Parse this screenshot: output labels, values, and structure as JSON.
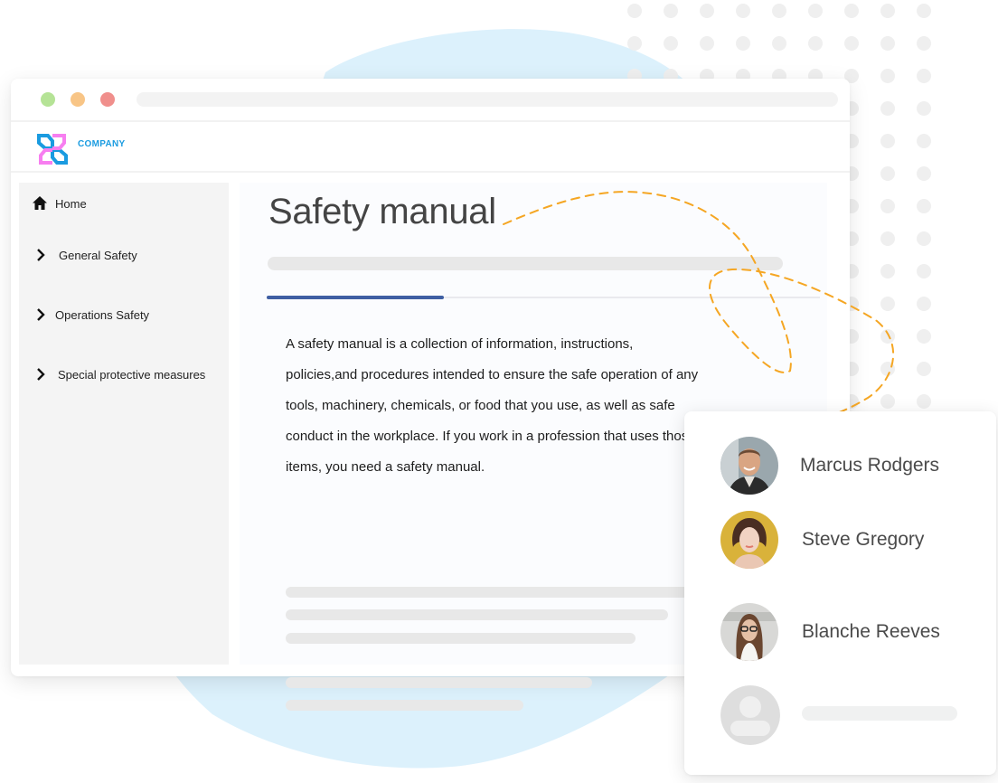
{
  "window": {
    "traffic_lights": [
      {
        "name": "green",
        "color": "#b5e396"
      },
      {
        "name": "yellow",
        "color": "#f8c586"
      },
      {
        "name": "red",
        "color": "#f08f8c"
      }
    ]
  },
  "app": {
    "brand_name": "COMPANY",
    "brand_color": "#1a9be0",
    "logo_colors": {
      "blue": "#1a9be0",
      "pink": "#f77ef0"
    }
  },
  "sidebar": {
    "items": [
      {
        "label": "Home",
        "icon": "home-icon"
      },
      {
        "label": "General Safety",
        "icon": "chevron-right-icon"
      },
      {
        "label": "Operations Safety",
        "icon": "chevron-right-icon"
      },
      {
        "label": "Special protective measures",
        "icon": "chevron-right-icon"
      }
    ]
  },
  "main": {
    "title": "Safety manual",
    "tab_progress_fraction": 0.32,
    "tab_accent_color": "#3f5fa3",
    "paragraph": "A safety manual is a collection of information, instructions, policies,and procedures intended to ensure the safe operation of any tools, machinery, chemicals, or food that you use, as well as safe conduct in the workplace. If you work in a profession that uses those items, you need a safety manual."
  },
  "people": {
    "members": [
      {
        "name": "Marcus Rodgers",
        "avatar": "man-photo"
      },
      {
        "name": "Steve Gregory",
        "avatar": "woman-photo-yellow-bg"
      },
      {
        "name": "Blanche Reeves",
        "avatar": "woman-glasses-photo"
      },
      {
        "name": "",
        "avatar": "user-placeholder-icon"
      }
    ]
  },
  "decoration": {
    "dash_color": "#f5a623",
    "blob_color": "#dcf1fc",
    "dot_color": "#efefef"
  }
}
